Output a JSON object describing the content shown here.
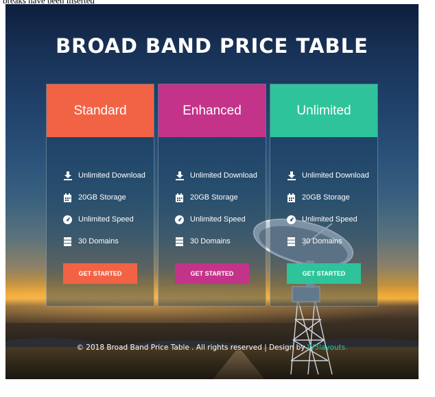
{
  "top_note": "breaks have been inserted",
  "page_title": "BROAD BAND PRICE TABLE",
  "colors": {
    "standard": "#f26346",
    "enhanced": "#c4338a",
    "unlimited": "#2ec39a"
  },
  "plans": [
    {
      "name": "Standard",
      "features": [
        {
          "icon": "download-icon",
          "label": "Unlimited Download"
        },
        {
          "icon": "calendar-icon",
          "label": "20GB Storage"
        },
        {
          "icon": "speedometer-icon",
          "label": "Unlimited Speed"
        },
        {
          "icon": "server-icon",
          "label": "30 Domains"
        }
      ],
      "button": "GET STARTED"
    },
    {
      "name": "Enhanced",
      "features": [
        {
          "icon": "download-icon",
          "label": "Unlimited Download"
        },
        {
          "icon": "calendar-icon",
          "label": "20GB Storage"
        },
        {
          "icon": "speedometer-icon",
          "label": "Unlimited Speed"
        },
        {
          "icon": "server-icon",
          "label": "30 Domains"
        }
      ],
      "button": "GET STARTED"
    },
    {
      "name": "Unlimited",
      "features": [
        {
          "icon": "download-icon",
          "label": "Unlimited Download"
        },
        {
          "icon": "calendar-icon",
          "label": "20GB Storage"
        },
        {
          "icon": "speedometer-icon",
          "label": "Unlimited Speed"
        },
        {
          "icon": "server-icon",
          "label": "30 Domains"
        }
      ],
      "button": "GET STARTED"
    }
  ],
  "footer": {
    "text": "© 2018 Broad Band Price Table . All rights reserved | Design by ",
    "link": "W3layouts."
  }
}
